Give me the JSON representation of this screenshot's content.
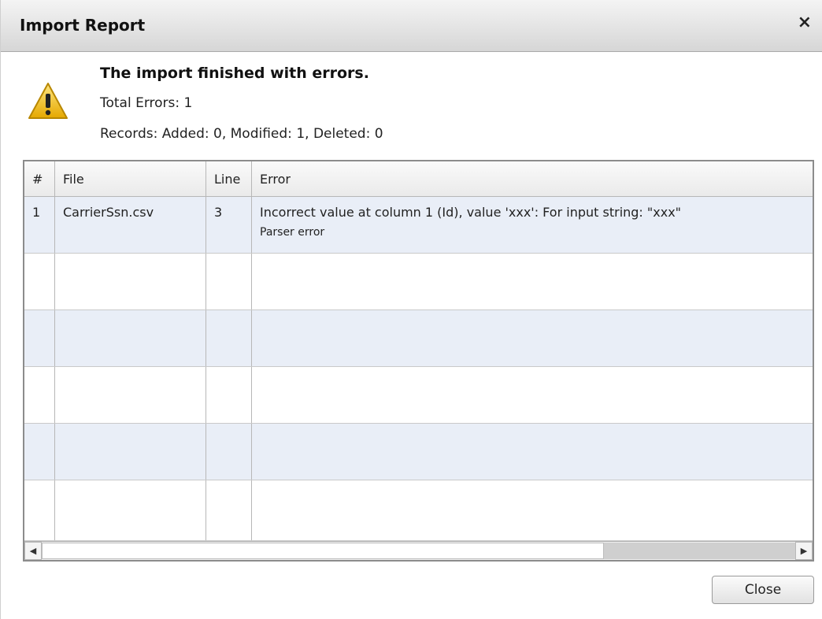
{
  "dialog": {
    "title": "Import Report",
    "close_glyph": "×"
  },
  "message": {
    "icon": "warning-icon",
    "headline": "The import finished with errors.",
    "total_errors": "Total Errors: 1",
    "records": "Records:  Added: 0, Modified: 1, Deleted: 0"
  },
  "table": {
    "columns": [
      "#",
      "File",
      "Line",
      "Error"
    ],
    "rows": [
      {
        "num": "1",
        "file": "CarrierSsn.csv",
        "line": "3",
        "error": "Incorrect value at column 1 (Id), value 'xxx': For input string: \"xxx\"",
        "error_detail": "Parser error"
      }
    ]
  },
  "scrollbar": {
    "left_glyph": "◀",
    "right_glyph": "▶"
  },
  "footer": {
    "close_label": "Close"
  },
  "colors": {
    "alt_row": "#e9eef7",
    "warning_yellow": "#f2c200"
  }
}
